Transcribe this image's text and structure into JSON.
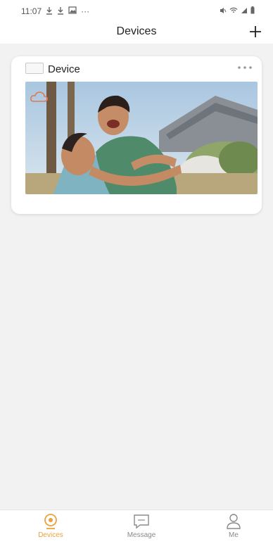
{
  "status_bar": {
    "time": "11:07",
    "more_indicator": "···",
    "icons_left": [
      "download-icon",
      "download-icon",
      "gallery-icon"
    ],
    "icons_right": [
      "mute-icon",
      "wifi-icon",
      "signal-icon",
      "battery-icon"
    ]
  },
  "header": {
    "title": "Devices",
    "add_icon": "plus-icon"
  },
  "device_card": {
    "name": "Device",
    "more_icon": "more-dots-icon",
    "cloud_icon": "cloud-icon",
    "preview_description_icon": "camera-snapshot"
  },
  "bottom_nav": {
    "items": [
      {
        "label": "Devices",
        "icon": "camera-icon",
        "active": true
      },
      {
        "label": "Message",
        "icon": "message-icon",
        "active": false
      },
      {
        "label": "Me",
        "icon": "person-icon",
        "active": false
      }
    ]
  },
  "colors": {
    "accent": "#e8a33b",
    "inactive": "#8a8a8a",
    "background": "#f2f2f2",
    "card": "#ffffff"
  }
}
